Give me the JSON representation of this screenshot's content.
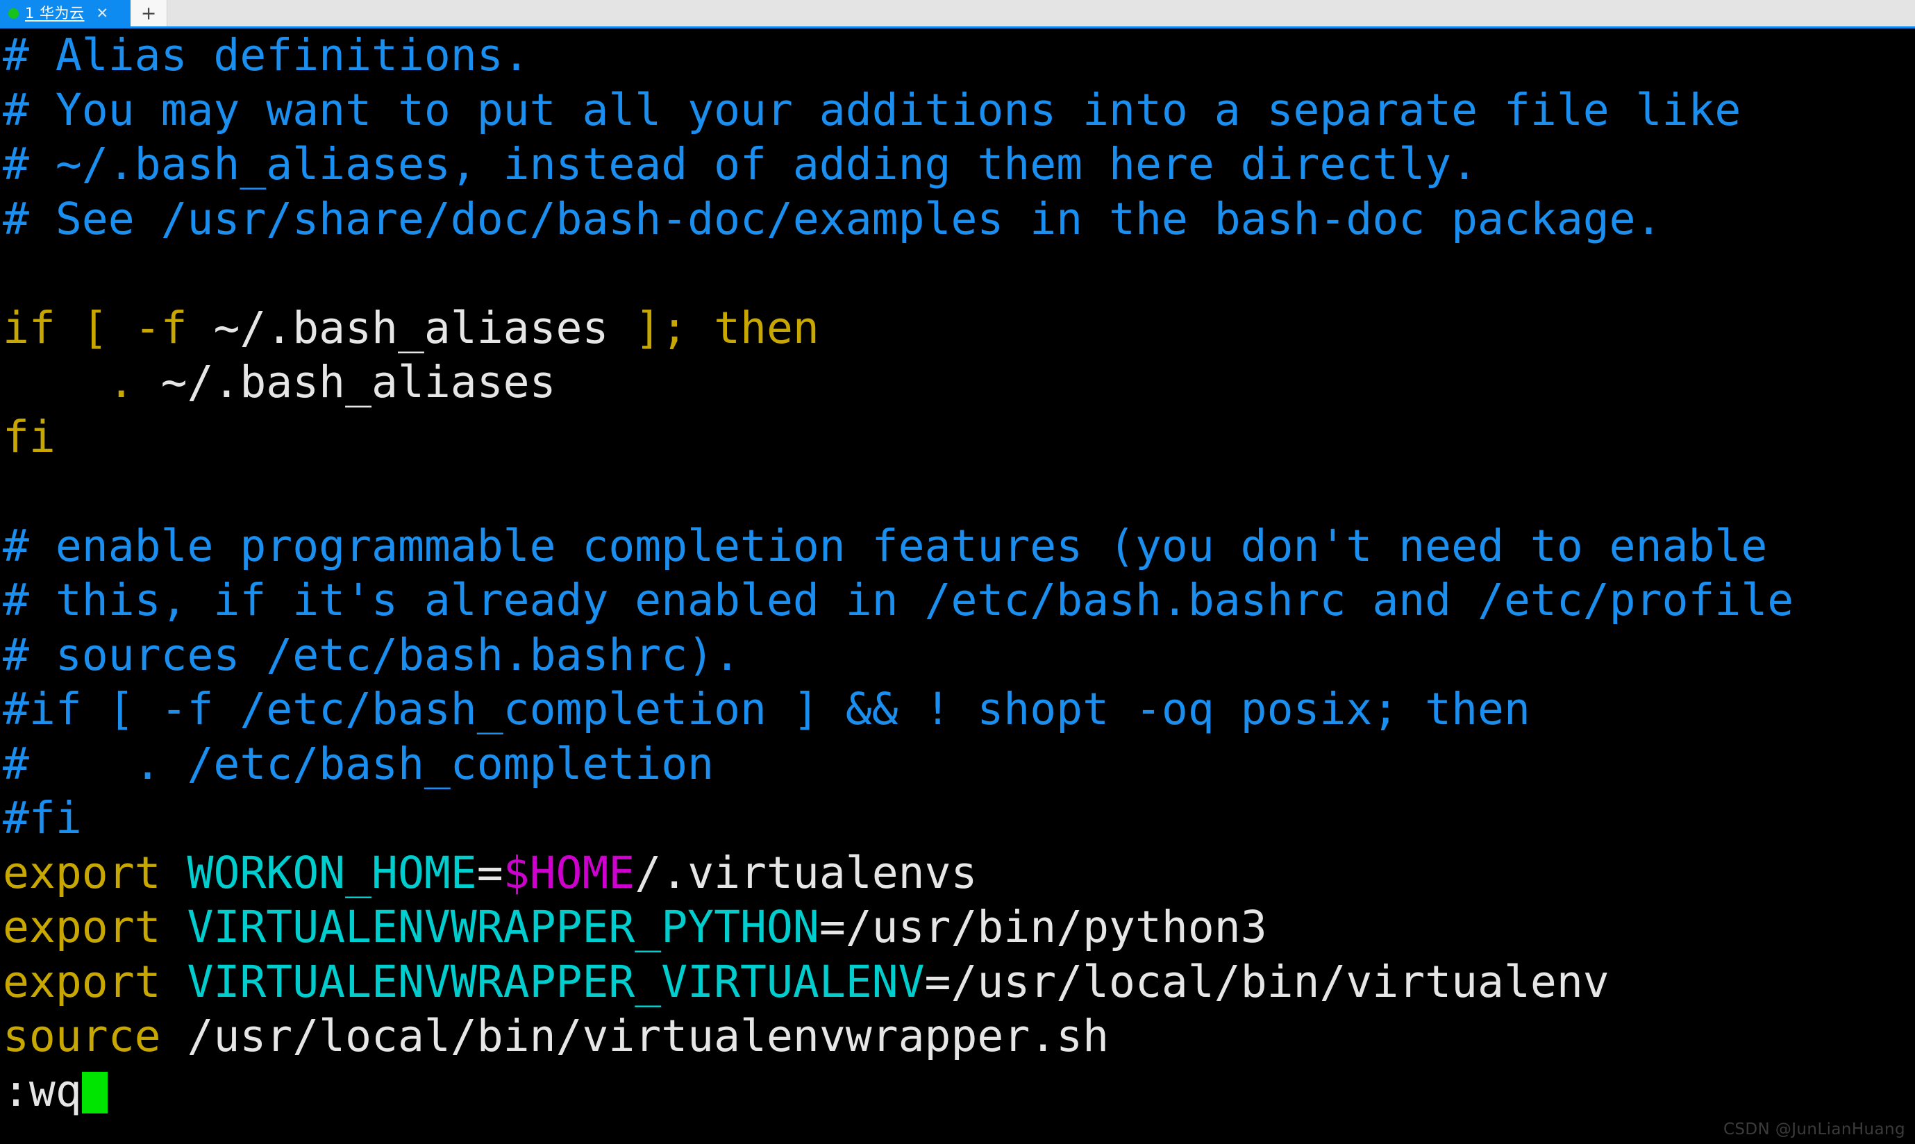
{
  "tabbar": {
    "status_dot": "green",
    "tab_label": "1 华为云",
    "close_glyph": "✕",
    "new_tab_glyph": "+"
  },
  "terminal": {
    "colors": {
      "background": "#000000",
      "comment": "#1a8fef",
      "keyword": "#c8a800",
      "plain": "#e6e6e6",
      "variable": "#00cdcd",
      "expansion": "#cd00cd",
      "cursor": "#00e500"
    },
    "lines": [
      {
        "id": "l1",
        "segments": [
          {
            "cls": "c-comment",
            "t": "# Alias definitions."
          }
        ]
      },
      {
        "id": "l2",
        "segments": [
          {
            "cls": "c-comment",
            "t": "# You may want to put all your additions into a separate file like"
          }
        ]
      },
      {
        "id": "l3",
        "segments": [
          {
            "cls": "c-comment",
            "t": "# ~/.bash_aliases, instead of adding them here directly."
          }
        ]
      },
      {
        "id": "l4",
        "segments": [
          {
            "cls": "c-comment",
            "t": "# See /usr/share/doc/bash-doc/examples in the bash-doc package."
          }
        ]
      },
      {
        "id": "l5",
        "segments": [
          {
            "cls": "c-text",
            "t": ""
          }
        ]
      },
      {
        "id": "l6",
        "segments": [
          {
            "cls": "c-key",
            "t": "if [ "
          },
          {
            "cls": "c-key",
            "t": "-f "
          },
          {
            "cls": "c-text",
            "t": "~/.bash_aliases "
          },
          {
            "cls": "c-key",
            "t": "]; then"
          }
        ]
      },
      {
        "id": "l7",
        "segments": [
          {
            "cls": "c-key",
            "t": "    . "
          },
          {
            "cls": "c-text",
            "t": "~/.bash_aliases"
          }
        ]
      },
      {
        "id": "l8",
        "segments": [
          {
            "cls": "c-key",
            "t": "fi"
          }
        ]
      },
      {
        "id": "l9",
        "segments": [
          {
            "cls": "c-text",
            "t": ""
          }
        ]
      },
      {
        "id": "l10",
        "segments": [
          {
            "cls": "c-comment",
            "t": "# enable programmable completion features (you don't need to enable"
          }
        ]
      },
      {
        "id": "l11",
        "segments": [
          {
            "cls": "c-comment",
            "t": "# this, if it's already enabled in /etc/bash.bashrc and /etc/profile"
          }
        ]
      },
      {
        "id": "l12",
        "segments": [
          {
            "cls": "c-comment",
            "t": "# sources /etc/bash.bashrc)."
          }
        ]
      },
      {
        "id": "l13",
        "segments": [
          {
            "cls": "c-comment",
            "t": "#if [ -f /etc/bash_completion ] && ! shopt -oq posix; then"
          }
        ]
      },
      {
        "id": "l14",
        "segments": [
          {
            "cls": "c-comment",
            "t": "#    . /etc/bash_completion"
          }
        ]
      },
      {
        "id": "l15",
        "segments": [
          {
            "cls": "c-comment",
            "t": "#fi"
          }
        ]
      },
      {
        "id": "l16",
        "segments": [
          {
            "cls": "c-key",
            "t": "export "
          },
          {
            "cls": "c-var",
            "t": "WORKON_HOME"
          },
          {
            "cls": "c-text",
            "t": "="
          },
          {
            "cls": "c-dollar",
            "t": "$HOME"
          },
          {
            "cls": "c-text",
            "t": "/.virtualenvs"
          }
        ]
      },
      {
        "id": "l17",
        "segments": [
          {
            "cls": "c-key",
            "t": "export "
          },
          {
            "cls": "c-var",
            "t": "VIRTUALENVWRAPPER_PYTHON"
          },
          {
            "cls": "c-text",
            "t": "=/usr/bin/python3"
          }
        ]
      },
      {
        "id": "l18",
        "segments": [
          {
            "cls": "c-key",
            "t": "export "
          },
          {
            "cls": "c-var",
            "t": "VIRTUALENVWRAPPER_VIRTUALENV"
          },
          {
            "cls": "c-text",
            "t": "=/usr/local/bin/virtualenv"
          }
        ]
      },
      {
        "id": "l19",
        "segments": [
          {
            "cls": "c-key",
            "t": "source "
          },
          {
            "cls": "c-text",
            "t": "/usr/local/bin/virtualenvwrapper.sh"
          }
        ]
      },
      {
        "id": "l20",
        "segments": [
          {
            "cls": "c-text",
            "t": ":wq"
          }
        ],
        "cursor": true
      }
    ]
  },
  "watermark": {
    "text": "CSDN @JunLianHuang"
  }
}
